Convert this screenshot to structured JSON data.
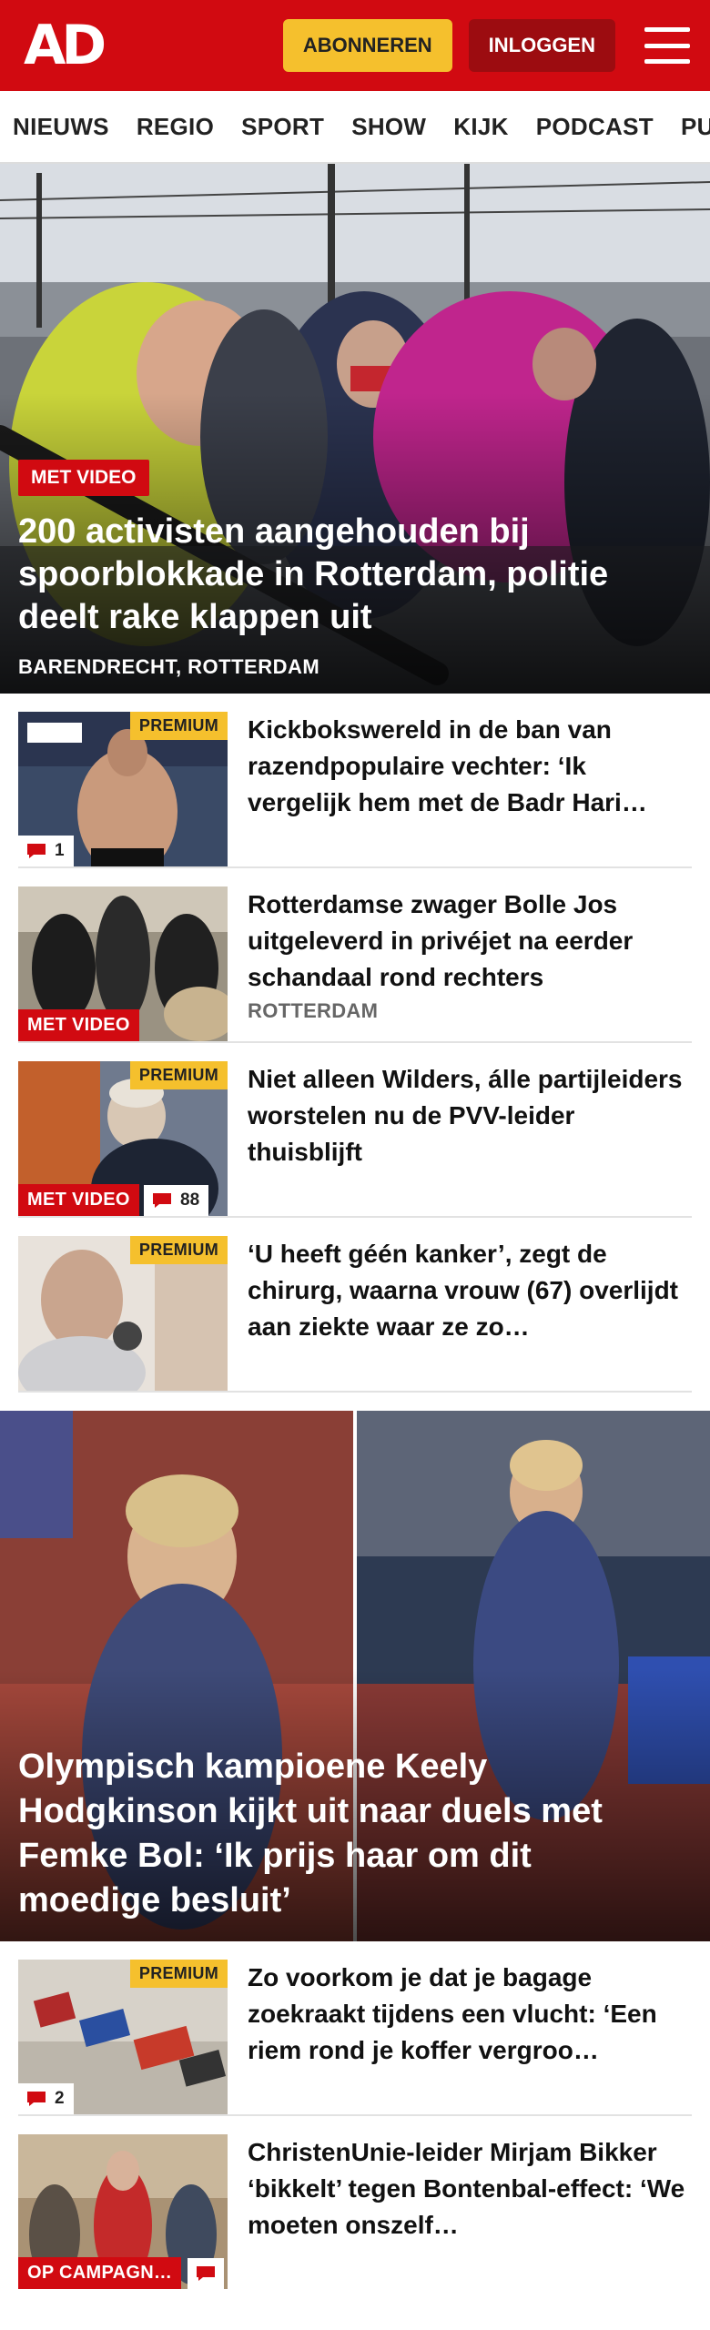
{
  "header": {
    "logo": "AD",
    "subscribe_label": "ABONNEREN",
    "login_label": "INLOGGEN",
    "brand_color": "#d10a11",
    "accent_color": "#f5c02d"
  },
  "nav": {
    "items": [
      "NIEUWS",
      "REGIO",
      "SPORT",
      "SHOW",
      "KIJK",
      "PODCAST",
      "PUZZ"
    ]
  },
  "hero": {
    "badge": "MET VIDEO",
    "title": "200 activisten aangehouden bij spoorblokkade in Rotterdam, politie deelt rake klappen uit",
    "location": "BARENDRECHT, ROTTERDAM"
  },
  "articles_top": [
    {
      "title": "Kickbokswereld in de ban van razendpopulaire vechter: ‘Ik vergelijk hem met de Badr Hari…",
      "premium": "PREMIUM",
      "comments": "1"
    },
    {
      "title": "Rotterdamse zwager Bolle Jos uitgeleverd in privéjet na eerder schandaal rond rechters",
      "video": "MET VIDEO",
      "location": "ROTTERDAM"
    },
    {
      "title": "Niet alleen Wilders, álle partijlei­ders worstelen nu de PVV-leider thuisblijft",
      "premium": "PREMIUM",
      "video": "MET VIDEO",
      "comments": "88"
    },
    {
      "title": "‘U heeft géén kanker’, zegt de chirurg, waarna vrouw (67) overlijdt aan ziekte waar ze zo…",
      "premium": "PREMIUM"
    }
  ],
  "feature": {
    "title": "Olympisch kampioene Keely Hodgkinson kijkt uit naar duels met Femke Bol: ‘Ik prijs haar om dit moedige besluit’"
  },
  "articles_bottom": [
    {
      "title": "Zo voorkom je dat je bagage zoekraakt tijdens een vlucht: ‘Een riem rond je koffer vergroo…",
      "premium": "PREMIUM",
      "comments": "2"
    },
    {
      "title": "ChristenUnie-leider Mirjam Bikker ‘bikkelt’ tegen Bontenbal-effect: ‘We moeten onszelf…",
      "video": "OP CAMPAGN…"
    }
  ]
}
